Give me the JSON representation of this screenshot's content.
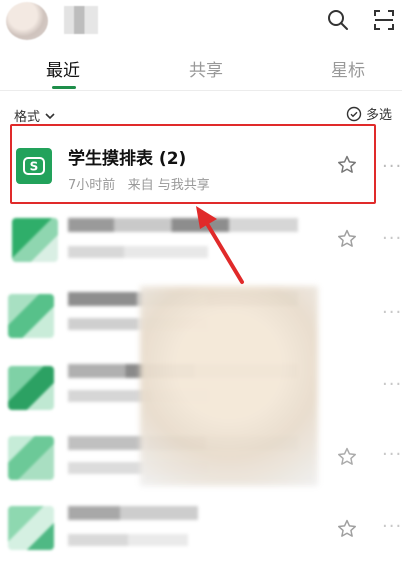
{
  "header": {
    "avatar_name": "avatar",
    "search_icon": "search-icon",
    "scan_icon": "scan-icon"
  },
  "tabs": [
    {
      "label": "最近",
      "active": true
    },
    {
      "label": "共享",
      "active": false
    },
    {
      "label": "星标",
      "active": false
    }
  ],
  "filter": {
    "format_label": "格式",
    "multi_select_label": "多选"
  },
  "highlighted_item": {
    "title": "学生摸排表 (2)",
    "meta": "7小时前   来自 与我共享",
    "icon_letter": "S",
    "icon_color": "#22a25b"
  },
  "colors": {
    "accent": "#1e8e4a",
    "highlight_border": "#e02a2a",
    "sheet_icon": "#22a25b"
  }
}
